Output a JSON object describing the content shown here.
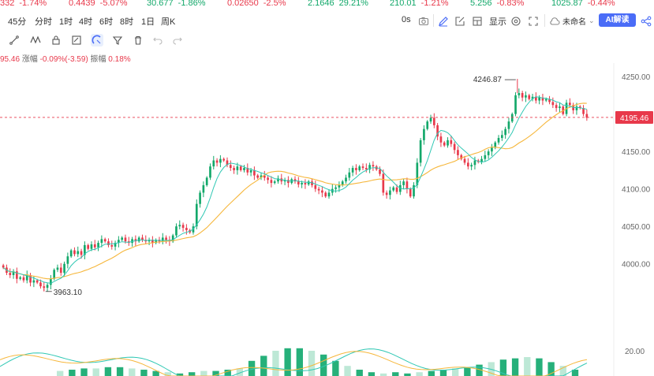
{
  "tickers": [
    {
      "price": "332",
      "change": "-1.74%",
      "color": "red"
    },
    {
      "price": "0.4439",
      "change": "-5.07%",
      "color": "red"
    },
    {
      "price": "30.677",
      "change": "-1.86%",
      "color": "green"
    },
    {
      "price": "0.02650",
      "change": "-2.5%",
      "color": "red"
    },
    {
      "price": "2.1646",
      "change": "29.21%",
      "color": "green"
    },
    {
      "price": "210.01",
      "change": "-1.21%",
      "color": "green"
    },
    {
      "price": "5.256",
      "change": "-0.83%",
      "color": "green"
    },
    {
      "price": "1025.87",
      "change": "-0.44%",
      "color": "green"
    }
  ],
  "timeframes": [
    "45分",
    "分时",
    "1时",
    "4时",
    "6时",
    "8时",
    "1日",
    "周K"
  ],
  "toolbar_right": {
    "zero_label": "0s",
    "display_label": "显示",
    "unnamed_label": "未命名",
    "ai_label": "AI解读"
  },
  "info": {
    "price_fragment": "95.46",
    "amplitude_label": "涨幅",
    "amplitude_value": "-0.09%(-3.59)",
    "range_label": "振幅",
    "range_value": "0.18%"
  },
  "colors": {
    "up": "#e8394b",
    "down": "#13a86a",
    "ma_fast": "#30c8b4",
    "ma_slow": "#f6b73c",
    "price_tag": "#e8394b",
    "accent": "#4a6cf7"
  },
  "chart_data": {
    "type": "candlestick",
    "y_range": [
      3905,
      4268
    ],
    "y_ticks": [
      "4250.00",
      "4200.00",
      "4150.00",
      "4100.00",
      "4050.00",
      "4000.00"
    ],
    "current_price": "4195.46",
    "max_annotation": "4246.87",
    "min_annotation": "3963.10",
    "indicator_label": "20.00",
    "closes": [
      3995,
      3988,
      3985,
      3990,
      3980,
      3982,
      3978,
      3985,
      3975,
      3978,
      3975,
      3970,
      3968,
      3972,
      3980,
      3992,
      3995,
      3988,
      4000,
      4010,
      4018,
      4013,
      4017,
      4012,
      4025,
      4020,
      4026,
      4022,
      4028,
      4033,
      4030,
      4025,
      4023,
      4028,
      4032,
      4035,
      4030,
      4028,
      4033,
      4030,
      4035,
      4032,
      4030,
      4032,
      4028,
      4032,
      4030,
      4035,
      4032,
      4030,
      4038,
      4050,
      4052,
      4048,
      4045,
      4042,
      4050,
      4080,
      4095,
      4105,
      4115,
      4130,
      4138,
      4135,
      4140,
      4138,
      4132,
      4128,
      4125,
      4130,
      4125,
      4128,
      4122,
      4125,
      4118,
      4115,
      4118,
      4115,
      4112,
      4108,
      4110,
      4114,
      4110,
      4112,
      4108,
      4113,
      4110,
      4106,
      4108,
      4106,
      4110,
      4105,
      4100,
      4098,
      4095,
      4090,
      4095,
      4100,
      4102,
      4105,
      4110,
      4115,
      4122,
      4128,
      4125,
      4130,
      4128,
      4126,
      4132,
      4130,
      4126,
      4120,
      4095,
      4092,
      4098,
      4102,
      4096,
      4105,
      4110,
      4100,
      4090,
      4105,
      4135,
      4165,
      4180,
      4190,
      4195,
      4185,
      4170,
      4162,
      4158,
      4165,
      4160,
      4152,
      4145,
      4140,
      4135,
      4130,
      4132,
      4138,
      4136,
      4140,
      4145,
      4150,
      4155,
      4162,
      4168,
      4172,
      4180,
      4190,
      4200,
      4225,
      4228,
      4222,
      4225,
      4220,
      4223,
      4218,
      4222,
      4218,
      4220,
      4216,
      4212,
      4208,
      4210,
      4200,
      4215,
      4212,
      4205,
      4210,
      4208,
      4200,
      4195
    ],
    "volume_bars": [
      4,
      5,
      6,
      6,
      7,
      7,
      6,
      5,
      4,
      3,
      2,
      3,
      4,
      4,
      5,
      6,
      12,
      16,
      20,
      22,
      22,
      20,
      17,
      12,
      8,
      5,
      3,
      2,
      3,
      2,
      3,
      4,
      5,
      6,
      7,
      9,
      11,
      13,
      14,
      15,
      14,
      11,
      8,
      5
    ]
  }
}
